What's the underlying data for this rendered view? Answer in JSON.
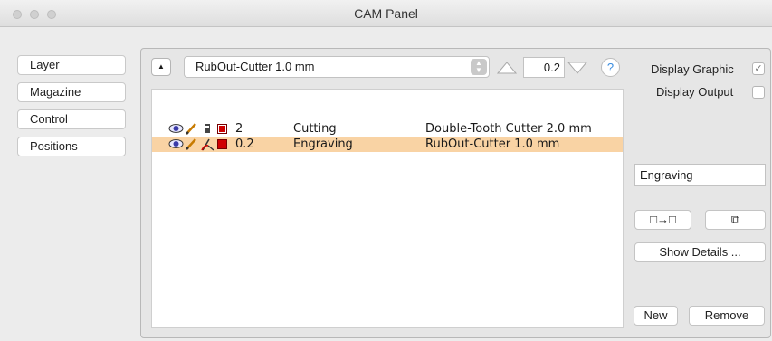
{
  "window": {
    "title": "CAM Panel"
  },
  "sidebar": {
    "items": [
      {
        "label": "Layer"
      },
      {
        "label": "Magazine"
      },
      {
        "label": "Control"
      },
      {
        "label": "Positions"
      }
    ]
  },
  "toolbar": {
    "collapse_glyph": "▲",
    "tool_select_value": "RubOut-Cutter 1.0 mm",
    "step_value": "0.2",
    "help_label": "?"
  },
  "layers": {
    "rows": [
      {
        "value": "2",
        "process": "Cutting",
        "tool": "Double-Tooth Cutter 2.0 mm",
        "selected": false,
        "color": "#d00000"
      },
      {
        "value": "0.2",
        "process": "Engraving",
        "tool": "RubOut-Cutter 1.0 mm",
        "selected": true,
        "color": "#d00000"
      }
    ]
  },
  "options": {
    "display_graphic_label": "Display Graphic",
    "display_graphic_checked": true,
    "display_output_label": "Display Output",
    "display_output_checked": false,
    "check_glyph": "✓"
  },
  "detail": {
    "name_value": "Engraving",
    "transfer_glyph": "□→□",
    "copy_glyph": "⧉",
    "show_details_label": "Show Details ...",
    "new_label": "New",
    "remove_label": "Remove"
  },
  "colors": {
    "selection": "#f9d3a4",
    "layer_red": "#d00000",
    "help_blue": "#3b8de0"
  }
}
